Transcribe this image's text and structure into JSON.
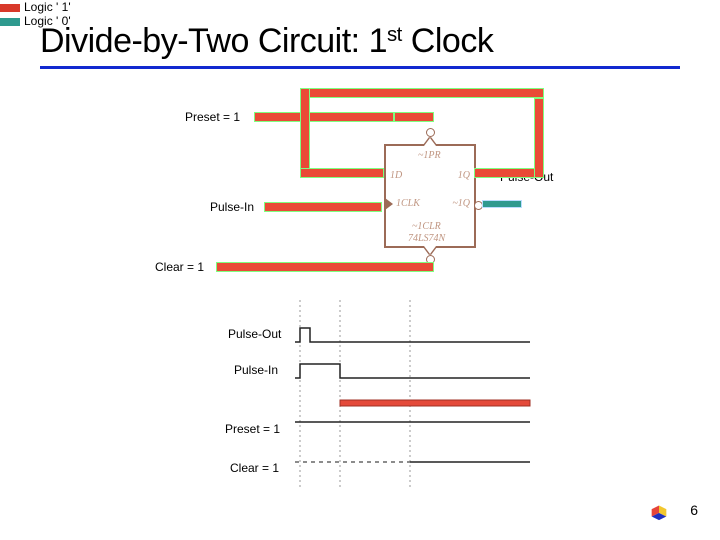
{
  "title_pre": "Divide-by-Two Circuit: 1",
  "title_sup": "st",
  "title_post": " Clock",
  "labels": {
    "preset": "Preset = 1",
    "pulse_out": "Pulse-Out",
    "pulse_in": "Pulse-In",
    "clear": "Clear = 1"
  },
  "legend": {
    "logic1": "Logic ' 1'",
    "logic0": "Logic ' 0'"
  },
  "legend_colors": {
    "logic1": "#d8392a",
    "logic0": "#2f9a8f"
  },
  "ic_pins": {
    "top": "~1PR",
    "left_top": "1D",
    "left_mid": "1CLK",
    "right_top": "1Q",
    "right_mid": "~1Q",
    "bottom": "~1CLR",
    "part": "74LS74N"
  },
  "timing": {
    "pulse_out": "Pulse-Out",
    "pulse_in": "Pulse-In",
    "preset": "Preset = 1",
    "clear": "Clear = 1"
  },
  "page_number": "6"
}
